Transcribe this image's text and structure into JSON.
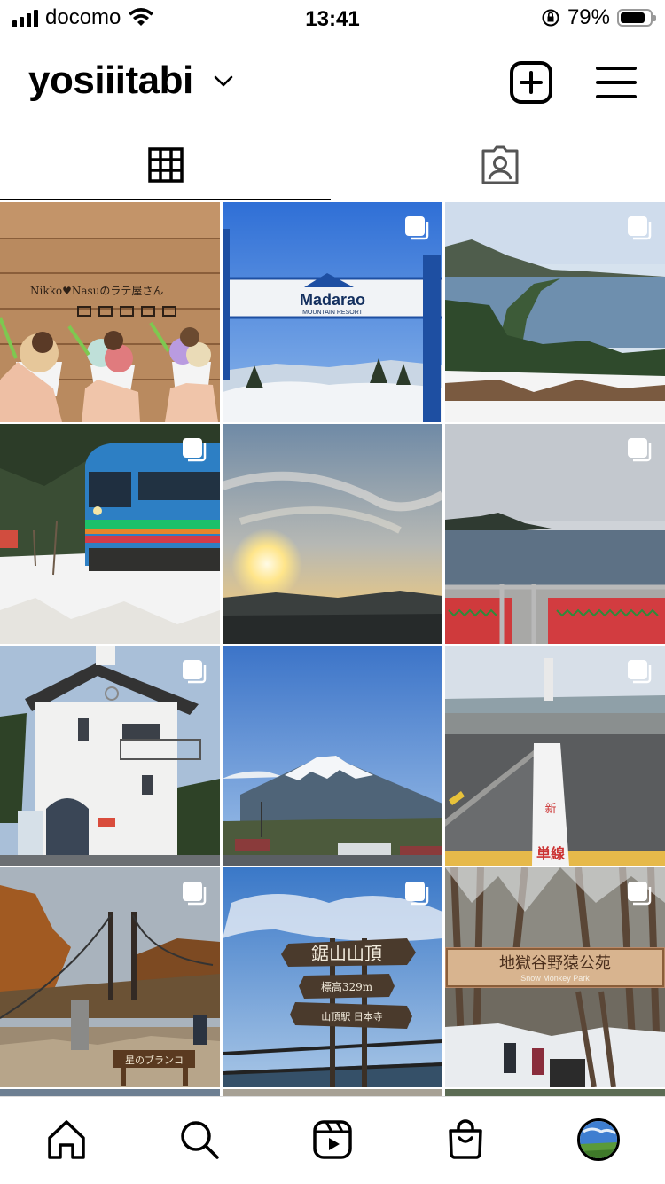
{
  "status_bar": {
    "carrier": "docomo",
    "time": "13:41",
    "battery_percent": "79%",
    "battery_level": 0.79,
    "icons": [
      "signal-icon",
      "wifi-icon",
      "orientation-lock-icon",
      "battery-icon"
    ]
  },
  "header": {
    "username": "yosiiitabi",
    "icons": [
      "chevron-down-icon",
      "new-post-icon",
      "menu-icon"
    ]
  },
  "tabs": [
    {
      "name": "grid",
      "icon": "grid-icon",
      "selected": true
    },
    {
      "name": "tagged",
      "icon": "tagged-icon",
      "selected": false
    }
  ],
  "posts": [
    {
      "subject": "gelato-cups",
      "text": "Nikko♥Nasuのラテ屋さん",
      "multi": false
    },
    {
      "subject": "madarao-sign",
      "text_main": "Madarao",
      "text_sub": "MOUNTAIN RESORT",
      "multi": true
    },
    {
      "subject": "amanohashidate",
      "multi": true
    },
    {
      "subject": "blue-train",
      "multi": true
    },
    {
      "subject": "sunset-sky",
      "multi": false
    },
    {
      "subject": "sea-coast",
      "multi": true
    },
    {
      "subject": "white-building",
      "multi": true
    },
    {
      "subject": "mount-fuji",
      "multi": false
    },
    {
      "subject": "station-line",
      "text": "単線",
      "multi": true
    },
    {
      "subject": "suspension-bridge",
      "text": "星のブランコ",
      "multi": true
    },
    {
      "subject": "nokogiri-summit",
      "sign_1": "鋸山山頂",
      "sign_2": "標高329m",
      "sign_3": "山頂駅 日本寺",
      "multi": true
    },
    {
      "subject": "snow-monkey-park",
      "text_main": "地獄谷野猿公苑",
      "text_sub": "Snow Monkey Park",
      "multi": true
    }
  ],
  "bottom_nav": [
    {
      "name": "home",
      "icon": "home-icon"
    },
    {
      "name": "search",
      "icon": "search-icon"
    },
    {
      "name": "reels",
      "icon": "reels-icon"
    },
    {
      "name": "shop",
      "icon": "shop-icon"
    },
    {
      "name": "profile",
      "icon": "profile-avatar"
    }
  ]
}
